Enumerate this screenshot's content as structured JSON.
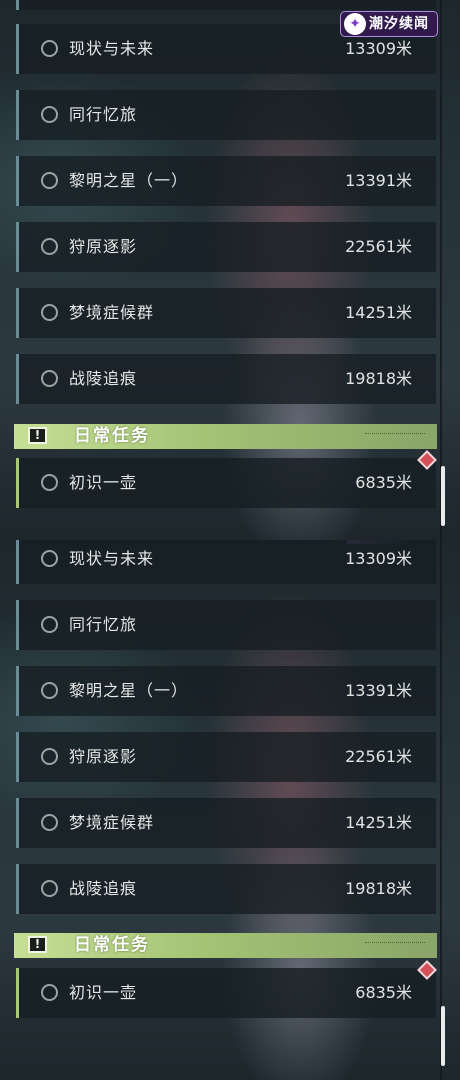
{
  "brand": {
    "text": "潮汐续闻",
    "icon": "star-swirl-icon",
    "color": "#7a3fc9"
  },
  "quest_list": [
    {
      "title": "现状与未来",
      "distance": "13309米"
    },
    {
      "title": "同行忆旅",
      "distance": ""
    },
    {
      "title": "黎明之星（一）",
      "distance": "13391米"
    },
    {
      "title": "狩原逐影",
      "distance": "22561米"
    },
    {
      "title": "梦境症候群",
      "distance": "14251米"
    },
    {
      "title": "战陵追痕",
      "distance": "19818米"
    }
  ],
  "daily_section": {
    "title": "日常任务",
    "icon": "exclamation-box-icon",
    "accent": "#a9c776",
    "items": [
      {
        "title": "初识一壶",
        "distance": "6835米",
        "badge": "new-diamond-icon"
      }
    ]
  },
  "colors": {
    "row_accent": "#6c8c95",
    "badge": "#d6505a"
  }
}
